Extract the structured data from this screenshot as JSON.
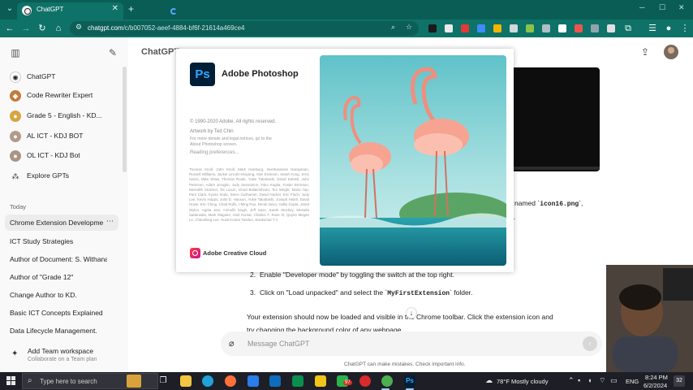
{
  "browser": {
    "tab_title": "ChatGPT",
    "tab_close": "✕",
    "new_tab": "+",
    "url_host": "chatgpt.com",
    "url_path": "/c/b007052-aeef-4884-bf6f-21614a469ce4",
    "accent_color": "#0e7268"
  },
  "sidebar": {
    "items": [
      {
        "label": "ChatGPT"
      },
      {
        "label": "Code Rewriter Expert"
      },
      {
        "label": "Grade 5 - English - KD..."
      },
      {
        "label": "AL ICT - KDJ BOT"
      },
      {
        "label": "OL ICT - KDJ Bot"
      },
      {
        "label": "Explore GPTs"
      }
    ],
    "section_today": "Today",
    "history": [
      {
        "label": "Chrome Extension Developme"
      },
      {
        "label": "ICT Study Strategies"
      },
      {
        "label": "Author of Document: S. Withanag"
      },
      {
        "label": "Author of \"Grade 12\""
      },
      {
        "label": "Change Author to KD."
      },
      {
        "label": "Basic ICT Concepts Explained"
      },
      {
        "label": "Data Lifecycle Management."
      }
    ],
    "team_title": "Add Team workspace",
    "team_sub": "Collaborate on a Team plan"
  },
  "main": {
    "title": "ChatGPT",
    "named_text": "named `",
    "named_file": "icon16.png",
    "named_tail": "`,",
    "frag_n": "n.",
    "step2_num": "2.",
    "step2_text": "Enable \"Developer mode\" by toggling the switch at the top right.",
    "step3_num": "3.",
    "step3_text_a": "Click on \"Load unpacked\" and select the `",
    "step3_folder": "MyFirstExtension",
    "step3_text_b": "` folder.",
    "para1": "Your extension should now be loaded and visible in the Chrome toolbar. Click the extension icon and",
    "para2": "try changing the background color of any webpage.",
    "composer_placeholder": "Message ChatGPT",
    "disclaimer": "ChatGPT can make mistakes. Check important info."
  },
  "splash": {
    "logo_text": "Ps",
    "app_name": "Adobe Photoshop",
    "copyright": "© 1990-2020 Adobe. All rights reserved.",
    "artwork": "Artwork by Ted Chin",
    "legal_1": "For more details and legal notices, go to the",
    "legal_2": "About Photoshop screen.",
    "reading": "Reading preferences...",
    "credits": "Thomas Knoll, John Knoll, Mark Hamburg, Seetharaman Narayanan, Russell Williams, Jackie Lincoln-Owyang, Alan Erickson, Sarah Kong, Jerry Harris, Mike Shaw, Thomas Ruark, Yukie Takahashi, David Dobish, John Peterson, Adam Jerugim, Judy Severance, Yuko Kagita, Foster Brereton, Meredith Stotzner, Tai Luxon, Vinod Balakrishnan, Tim Wright, Maria Yap, Pam Clark, Kyoko Itoda, Steve Guilhamet, David Hackel, Eric Floch, Judy Lee, Kevin Hopps, John E. Hanson, Yukie Takahashi, Joseph Hsieh, David Howe, Eric Ching, Chad Rolfs, I-Ming Pao, Derek Novo, Hollis Gupta, Jared Wyles, Agrita Jain, Anirudh Singh, Jeff Sass, Sarah Stuckey, Mustafa Sattarwala, Mark Maguire, Amit Kumar, Charles F. Rose III, Quynn Megan Le, Chaoshing Lee, Sunil Kumar Tandon, Sivakumar T A",
    "cc_name": "Adobe Creative Cloud"
  },
  "taskbar": {
    "search_placeholder": "Type here to search",
    "weather": "78°F  Mostly cloudy",
    "lang": "ENG",
    "time": "8:24 PM",
    "date": "6/2/2024",
    "notif_count": "32",
    "badge_count": "97"
  }
}
